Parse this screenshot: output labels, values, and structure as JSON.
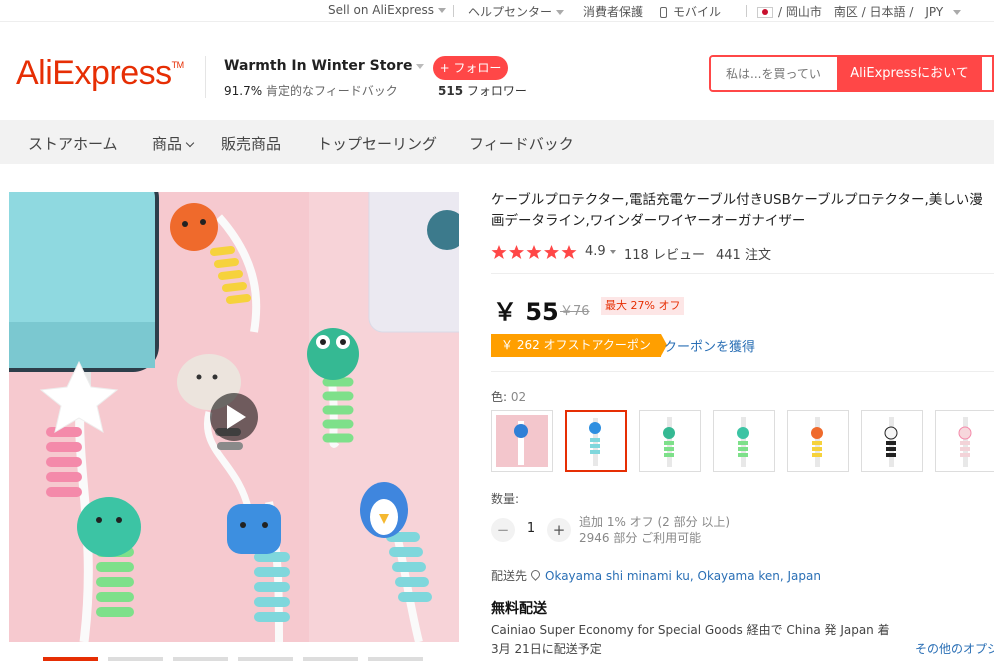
{
  "topbar": {
    "sell": "Sell on AliExpress",
    "help": "ヘルプセンター",
    "protection": "消費者保護",
    "mobile": "モバイル",
    "region": "/ 岡山市　南区 / 日本語 /　JPY"
  },
  "header": {
    "logo": "AliExpress",
    "store_name": "Warmth In Winter Store",
    "feedback_pct": "91.7%",
    "feedback_label": "肯定的なフィードバック",
    "follow_button": "+ フォロー",
    "followers_count": "515",
    "followers_label": "フォロワー",
    "search_placeholder": "私は...を買ってい",
    "search_button": "AliExpressにおいて"
  },
  "store_nav": {
    "home": "ストアホーム",
    "products": "商品",
    "sale": "販売商品",
    "top_selling": "トップセーリング",
    "feedback": "フィードバック"
  },
  "product": {
    "title": "ケーブルプロテクター,電話充電ケーブル付きUSBケーブルプロテクター,美しい漫画データライン,ワインダーワイヤーオーガナイザー",
    "rating": "4.9",
    "rating_stars": 5,
    "reviews": "118 レビュー",
    "orders": "441 注文",
    "price": "￥ 55",
    "old_price": "￥76",
    "discount": "最大 27% オフ",
    "coupon": "￥ 262 オフストアクーポン",
    "coupon_link": "クーポンを獲得",
    "color_label": "色:",
    "color_value": "02",
    "quantity_label": "数量:",
    "quantity": "1",
    "qty_minus": "−",
    "qty_plus": "+",
    "bulk_note": "追加 1% オフ (2 部分 以上)",
    "stock_note": "2946 部分 ご利用可能",
    "ship_to_label": "配送先",
    "ship_to": "Okayama shi minami ku, Okayama ken, Japan",
    "free_shipping": "無料配送",
    "ship_via": "Cainiao Super Economy for Special Goods 経由で China 発 Japan 着",
    "delivery": "3月 21日に配送予定",
    "other_options": "その他のオプシ"
  },
  "colors": {
    "accent": "#ff4747",
    "brand": "#e62e04",
    "coupon": "#ff9f00",
    "link": "#2a6fb5",
    "star": "#ff4747"
  }
}
